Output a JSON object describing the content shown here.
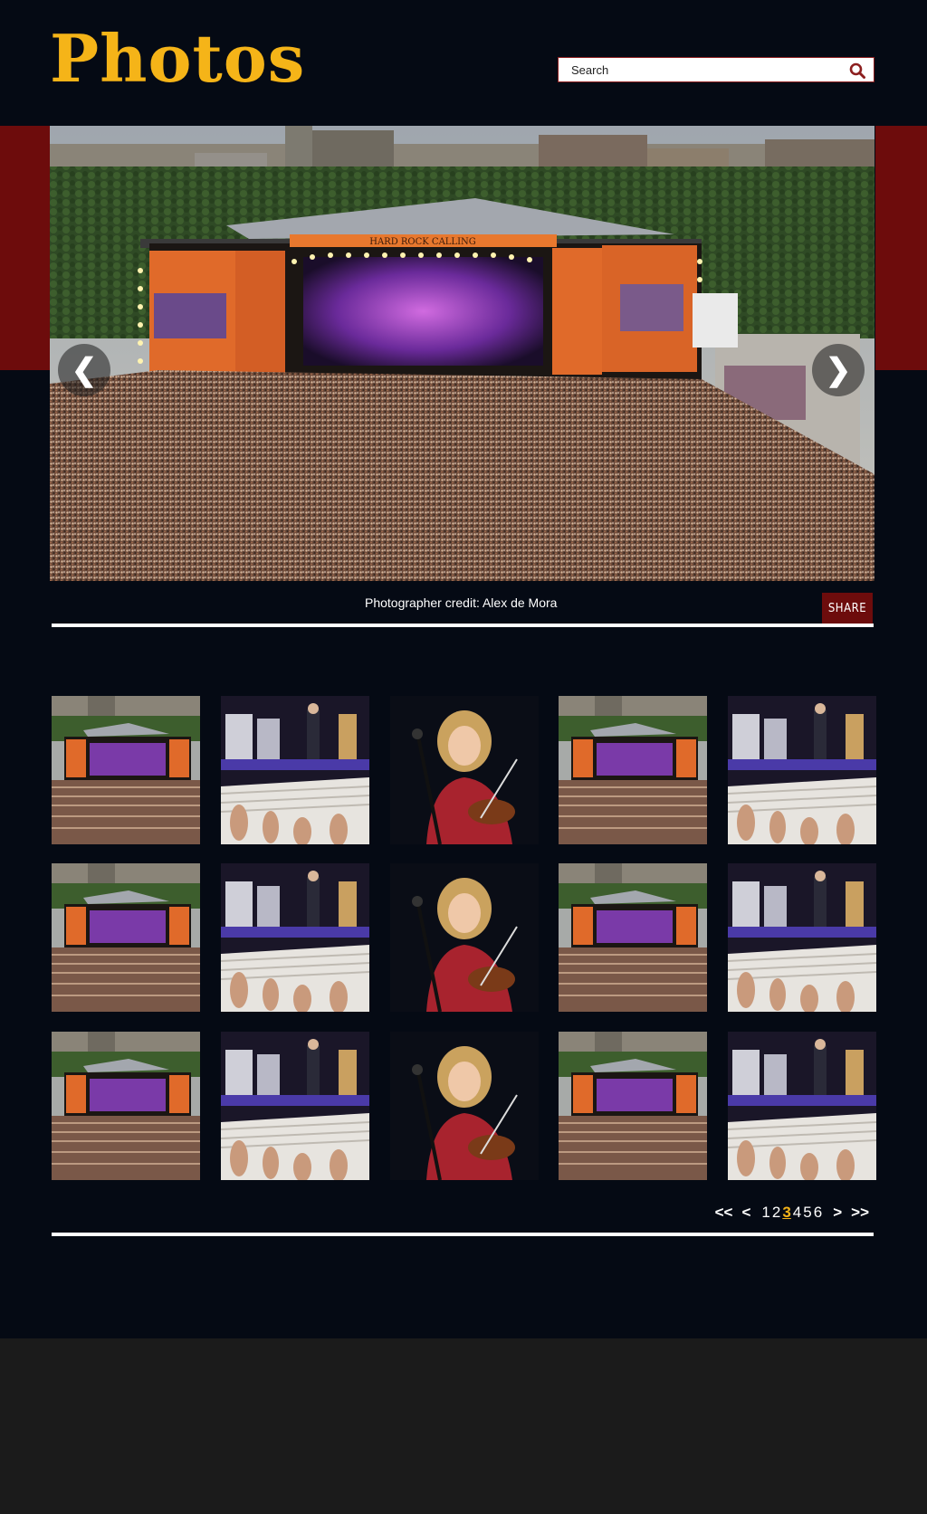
{
  "header": {
    "title": "Photos"
  },
  "search": {
    "placeholder": "Search",
    "icon": "search-icon"
  },
  "gallery": {
    "credit": "Photographer credit: Alex de Mora",
    "share_label": "SHARE",
    "prev_glyph": "❮",
    "next_glyph": "❯"
  },
  "thumbnails": [
    "festival-stage-crowd",
    "band-on-stage",
    "fiddle-player",
    "festival-stage-crowd",
    "band-on-stage",
    "festival-stage-crowd",
    "band-on-stage",
    "fiddle-player",
    "festival-stage-crowd",
    "band-on-stage",
    "festival-stage-crowd",
    "band-on-stage",
    "fiddle-player",
    "festival-stage-crowd",
    "band-on-stage"
  ],
  "pagination": {
    "first": "<<",
    "prev": "<",
    "pages": [
      "1",
      "2",
      "3",
      "4",
      "5",
      "6"
    ],
    "current": "3",
    "next": ">",
    "last": ">>"
  },
  "colors": {
    "accent": "#f5b418",
    "brand_red": "#6d0c0c",
    "background": "#050a14",
    "footer": "#1b1b1b"
  }
}
